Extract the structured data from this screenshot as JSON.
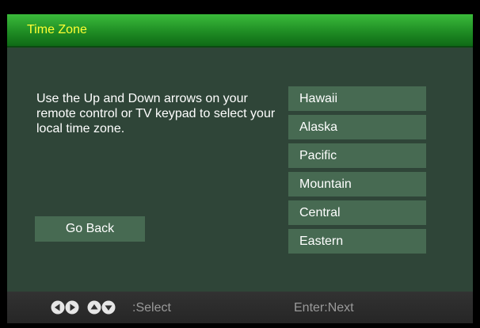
{
  "header": {
    "title": "Time Zone"
  },
  "instructions": "Use the Up and Down arrows on your remote control or TV keypad to select your local time zone.",
  "go_back_label": "Go Back",
  "time_zones": [
    "Hawaii",
    "Alaska",
    "Pacific",
    "Mountain",
    "Central",
    "Eastern"
  ],
  "footer": {
    "nav_icons": [
      "left-arrow-icon",
      "right-arrow-icon",
      "up-arrow-icon",
      "down-arrow-icon"
    ],
    "select_hint": ":Select",
    "next_hint": "Enter:Next"
  },
  "colors": {
    "title_bar": "#1f8d24",
    "title_text": "#ffff33",
    "panel": "#2f4538",
    "item": "#476a52",
    "footer": "#2b2b2b",
    "footer_text": "#9a9a9a"
  }
}
